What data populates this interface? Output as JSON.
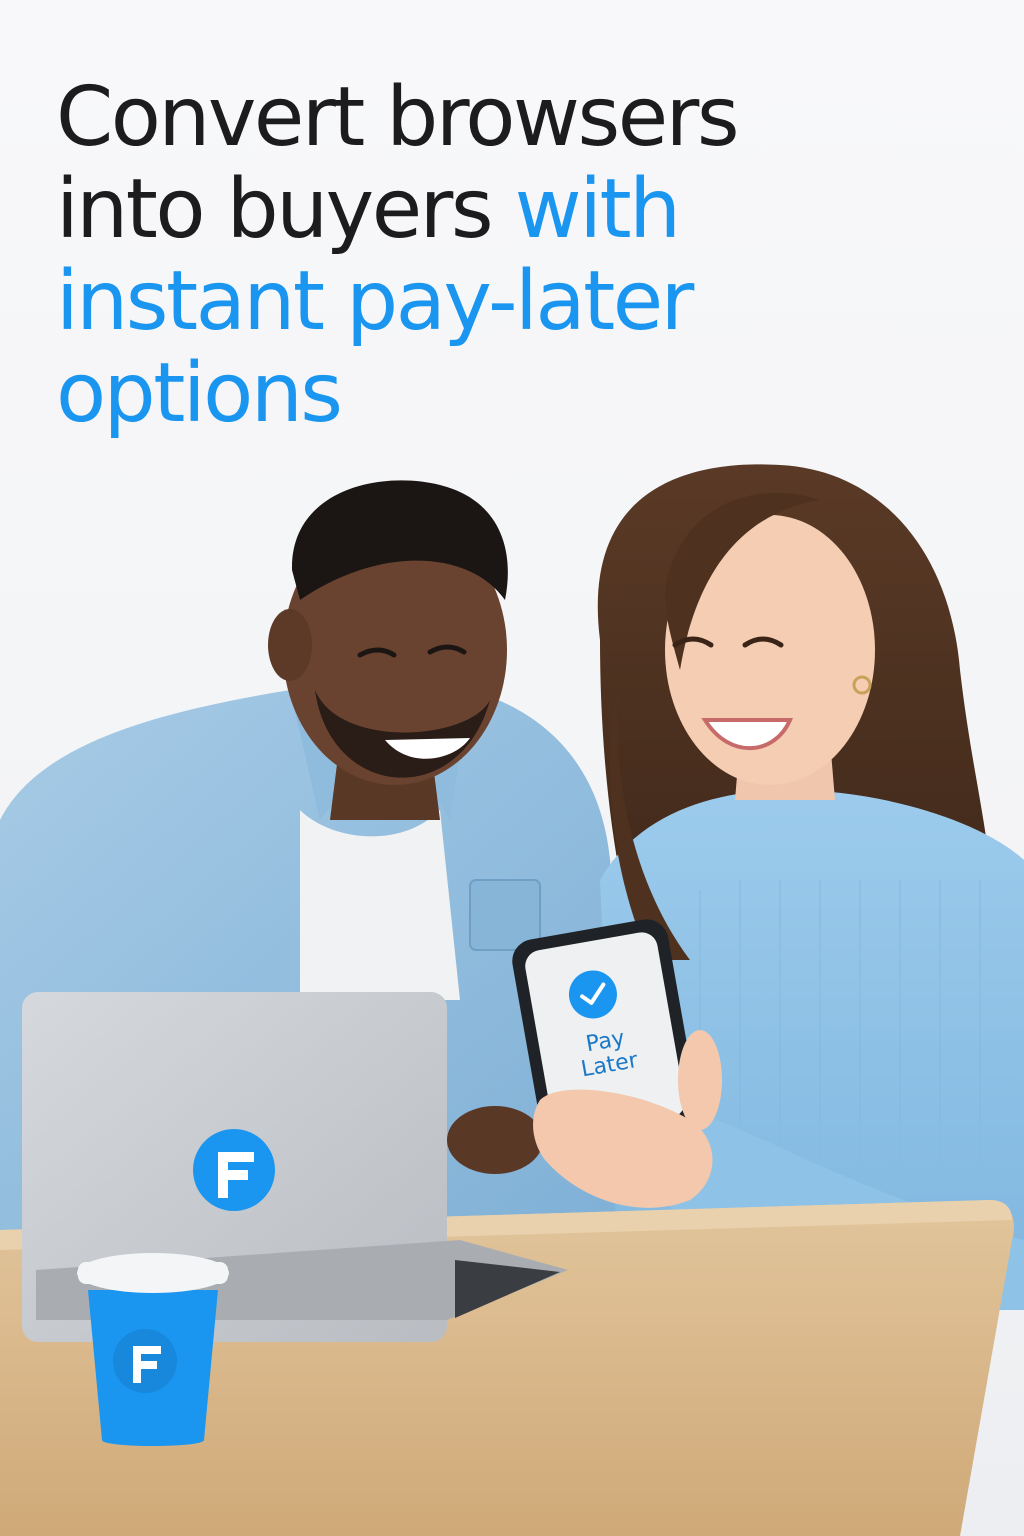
{
  "headline": {
    "line1": "Convert browsers",
    "line2_dark": "into buyers ",
    "line2_blue": "with",
    "line3_blue": "instant pay-later",
    "line4_blue": "options"
  },
  "phone": {
    "label_line1": "Pay",
    "label_line2": "Later"
  },
  "colors": {
    "accent": "#1a96f0",
    "text": "#1c1c1e",
    "denim": "#8fbcdc",
    "sweater": "#8ec2e6",
    "table": "#d8b88c"
  },
  "icons": {
    "laptop_logo": "brand-f-logo-icon",
    "cup_logo": "brand-f-logo-icon",
    "phone_check": "checkmark-circle-icon"
  }
}
